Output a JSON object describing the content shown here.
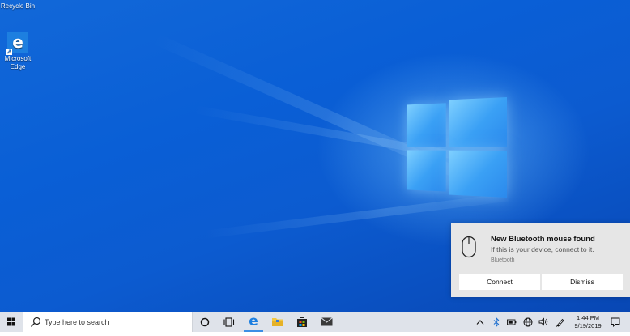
{
  "desktop": {
    "icons": [
      {
        "label": "Recycle Bin"
      },
      {
        "label_line1": "Microsoft",
        "label_line2": "Edge"
      }
    ]
  },
  "toast": {
    "title": "New Bluetooth mouse found",
    "body": "If this is your device, connect to it.",
    "source": "Bluetooth",
    "connect_label": "Connect",
    "dismiss_label": "Dismiss"
  },
  "taskbar": {
    "search_placeholder": "Type here to search",
    "pinned": [
      "cortana-icon",
      "task-view-icon",
      "edge-icon",
      "file-explorer-icon",
      "store-icon",
      "mail-icon"
    ],
    "tray": [
      "show-hidden-icons",
      "bluetooth-icon",
      "battery-icon",
      "network-icon",
      "volume-icon",
      "pen-icon"
    ],
    "time": "1:44 PM",
    "date": "9/19/2019"
  },
  "colors": {
    "wallpaper": "#0a5fd6",
    "taskbar": "#dfe3ea",
    "toast": "#e6e6e6",
    "accent": "#1d7fe0"
  }
}
